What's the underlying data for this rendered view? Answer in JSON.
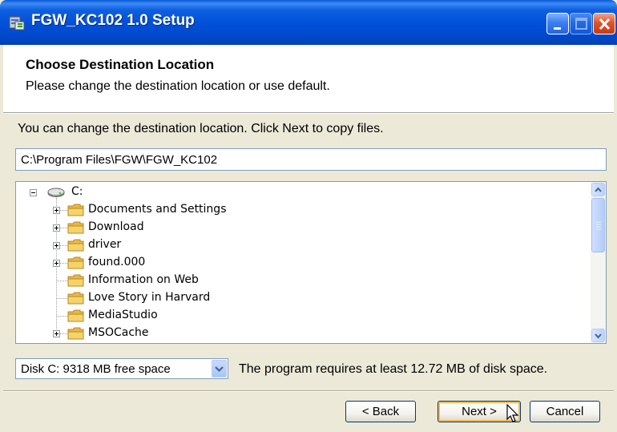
{
  "window": {
    "title": "FGW_KC102 1.0 Setup",
    "controls": [
      "minimize",
      "maximize",
      "close"
    ]
  },
  "header": {
    "heading": "Choose Destination Location",
    "subheading": "Please change the destination location or use default."
  },
  "instruction": "You can change the destination location. Click Next to copy files.",
  "destination_path": "C:\\Program Files\\FGW\\FGW_KC102",
  "tree": {
    "root": "C:",
    "items": [
      {
        "label": "Documents and Settings",
        "expandable": true
      },
      {
        "label": "Download",
        "expandable": true
      },
      {
        "label": "driver",
        "expandable": true
      },
      {
        "label": "found.000",
        "expandable": true
      },
      {
        "label": "Information on Web",
        "expandable": false
      },
      {
        "label": "Love Story in Harvard",
        "expandable": false
      },
      {
        "label": "MediaStudio",
        "expandable": false
      },
      {
        "label": "MSOCache",
        "expandable": true
      }
    ]
  },
  "drive_select": {
    "value": "Disk C: 9318 MB free space"
  },
  "requirement": "The program requires at least  12.72 MB of disk space.",
  "buttons": {
    "back": "< Back",
    "next": "Next >",
    "cancel": "Cancel"
  },
  "colors": {
    "titlebar": "#0050d8",
    "face": "#ece9d8",
    "close": "#e0542c",
    "folder": "#f5d36b",
    "default_button_glow": "#f8b84c"
  }
}
